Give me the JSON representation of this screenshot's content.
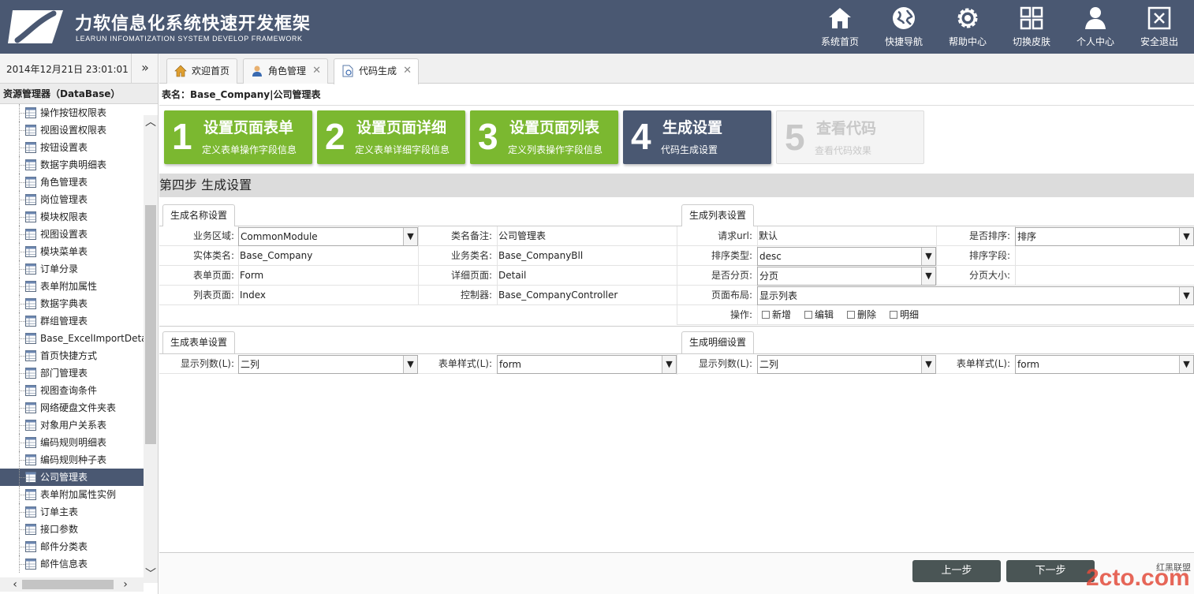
{
  "header": {
    "title": "力软信息化系统快速开发框架",
    "subtitle": "LEARUN INFOMATIZATION SYSTEM DEVELOP FRAMEWORK",
    "bg_color": "#4a5872",
    "nav": [
      {
        "label": "系统首页",
        "icon": "home-icon"
      },
      {
        "label": "快捷导航",
        "icon": "globe-icon"
      },
      {
        "label": "帮助中心",
        "icon": "gear-icon"
      },
      {
        "label": "切换皮肤",
        "icon": "grid-icon"
      },
      {
        "label": "个人中心",
        "icon": "user-icon"
      },
      {
        "label": "安全退出",
        "icon": "exit-icon"
      }
    ]
  },
  "datebar": {
    "datetime": "2014年12月21日 23:01:01",
    "collapse": "»"
  },
  "tabs": [
    {
      "label": "欢迎首页",
      "icon": "home-icon",
      "closable": false,
      "active": false
    },
    {
      "label": "角色管理",
      "icon": "user-icon",
      "closable": true,
      "active": false
    },
    {
      "label": "代码生成",
      "icon": "document-icon",
      "closable": true,
      "active": true
    }
  ],
  "sidebar": {
    "title": "资源管理器（DataBase）",
    "items": [
      "操作按钮权限表",
      "视图设置权限表",
      "按钮设置表",
      "数据字典明细表",
      "角色管理表",
      "岗位管理表",
      "模块权限表",
      "视图设置表",
      "模块菜单表",
      "订单分录",
      "表单附加属性",
      "数据字典表",
      "群组管理表",
      "Base_ExcelImportDetai",
      "首页快捷方式",
      "部门管理表",
      "视图查询条件",
      "网络硬盘文件夹表",
      "对象用户关系表",
      "编码规则明细表",
      "编码规则种子表",
      "公司管理表",
      "表单附加属性实例",
      "订单主表",
      "接口参数",
      "邮件分类表",
      "邮件信息表"
    ],
    "selected_index": 21
  },
  "main": {
    "table_title": "表名：Base_Company|公司管理表",
    "steps": [
      {
        "num": "1",
        "title": "设置页面表单",
        "desc": "定义表单操作字段信息",
        "state": "done"
      },
      {
        "num": "2",
        "title": "设置页面详细",
        "desc": "定义表单详细字段信息",
        "state": "done"
      },
      {
        "num": "3",
        "title": "设置页面列表",
        "desc": "定义列表操作字段信息",
        "state": "done"
      },
      {
        "num": "4",
        "title": "生成设置",
        "desc": "代码生成设置",
        "state": "current"
      },
      {
        "num": "5",
        "title": "查看代码",
        "desc": "查看代码效果",
        "state": "disabled"
      }
    ],
    "section_title": "第四步 生成设置",
    "name_group": {
      "tab": "生成名称设置",
      "fields": {
        "area_label": "业务区域:",
        "area_value": "CommonModule",
        "class_note_label": "类名备注:",
        "class_note_value": "公司管理表",
        "entity_label": "实体类名:",
        "entity_value": "Base_Company",
        "biz_label": "业务类名:",
        "biz_value": "Base_CompanyBll",
        "form_label": "表单页面:",
        "form_value": "Form",
        "detail_label": "详细页面:",
        "detail_value": "Detail",
        "list_label": "列表页面:",
        "list_value": "Index",
        "controller_label": "控制器:",
        "controller_value": "Base_CompanyController"
      }
    },
    "list_group": {
      "tab": "生成列表设置",
      "fields": {
        "url_label": "请求url:",
        "url_value": "默认",
        "sort_label": "是否排序:",
        "sort_value": "排序",
        "sort_type_label": "排序类型:",
        "sort_type_value": "desc",
        "sort_field_label": "排序字段:",
        "sort_field_value": "",
        "paging_label": "是否分页:",
        "paging_value": "分页",
        "page_size_label": "分页大小:",
        "page_size_value": "",
        "layout_label": "页面布局:",
        "layout_value": "显示列表",
        "ops_label": "操作:",
        "ops": [
          "新增",
          "编辑",
          "删除",
          "明细"
        ]
      }
    },
    "form_group": {
      "tab": "生成表单设置",
      "cols_label": "显示列数(L):",
      "cols_value": "二列",
      "style_label": "表单样式(L):",
      "style_value": "form"
    },
    "detail_group": {
      "tab": "生成明细设置",
      "cols_label": "显示列数(L):",
      "cols_value": "二列",
      "style_label": "表单样式(L):",
      "style_value": "form"
    },
    "buttons": {
      "prev": "上一步",
      "next": "下一步"
    },
    "watermark": {
      "logo": "2cto.com",
      "text": "红黑联盟"
    }
  },
  "colors": {
    "accent_green": "#7bb830",
    "accent_navy": "#4a5872"
  }
}
